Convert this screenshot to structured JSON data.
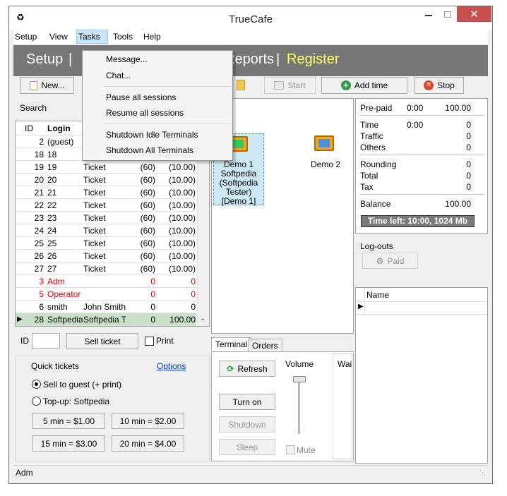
{
  "window": {
    "title": "TrueCafe"
  },
  "menu": {
    "setup": "Setup",
    "view": "View",
    "tasks": "Tasks",
    "tools": "Tools",
    "help": "Help"
  },
  "header": {
    "setup": "Setup",
    "sep1": "|",
    "reports": "Reports",
    "sep2": "|",
    "register": "Register"
  },
  "tasks_menu": {
    "message": "Message...",
    "chat": "Chat...",
    "pause_all": "Pause all sessions",
    "resume_all": "Resume all sessions",
    "shutdown_idle": "Shutdown Idle Terminals",
    "shutdown_all": "Shutdown All Terminals"
  },
  "toolbar": {
    "new_label": "New...",
    "start_label": "Start",
    "add_time_label": "Add time",
    "stop_label": "Stop"
  },
  "search_label": "Search",
  "accounts": {
    "headers": {
      "id": "ID",
      "login": "Login"
    },
    "rows": [
      {
        "id": "2",
        "login": "(guest)",
        "type": "",
        "time": "",
        "amount": "",
        "color": "normal"
      },
      {
        "id": "18",
        "login": "18",
        "type": "Ticket",
        "time": "",
        "amount": "",
        "color": "normal"
      },
      {
        "id": "19",
        "login": "19",
        "type": "Ticket",
        "time": "(60)",
        "amount": "(10.00)",
        "color": "normal"
      },
      {
        "id": "20",
        "login": "20",
        "type": "Ticket",
        "time": "(60)",
        "amount": "(10.00)",
        "color": "normal"
      },
      {
        "id": "21",
        "login": "21",
        "type": "Ticket",
        "time": "(60)",
        "amount": "(10.00)",
        "color": "normal"
      },
      {
        "id": "22",
        "login": "22",
        "type": "Ticket",
        "time": "(60)",
        "amount": "(10.00)",
        "color": "normal"
      },
      {
        "id": "23",
        "login": "23",
        "type": "Ticket",
        "time": "(60)",
        "amount": "(10.00)",
        "color": "normal"
      },
      {
        "id": "24",
        "login": "24",
        "type": "Ticket",
        "time": "(60)",
        "amount": "(10.00)",
        "color": "normal"
      },
      {
        "id": "25",
        "login": "25",
        "type": "Ticket",
        "time": "(60)",
        "amount": "(10.00)",
        "color": "normal"
      },
      {
        "id": "26",
        "login": "26",
        "type": "Ticket",
        "time": "(60)",
        "amount": "(10.00)",
        "color": "normal"
      },
      {
        "id": "27",
        "login": "27",
        "type": "Ticket",
        "time": "(60)",
        "amount": "(10.00)",
        "color": "normal"
      },
      {
        "id": "3",
        "login": "Adm",
        "type": "",
        "time": "0",
        "amount": "0",
        "color": "red"
      },
      {
        "id": "5",
        "login": "Operator",
        "type": "",
        "time": "0",
        "amount": "0",
        "color": "red"
      },
      {
        "id": "6",
        "login": "smith",
        "type": "John Smith",
        "time": "0",
        "amount": "0",
        "color": "normal"
      },
      {
        "id": "28",
        "login": "Softpedia",
        "type": "Softpedia Te",
        "time": "0",
        "amount": "100.00",
        "color": "selected"
      }
    ]
  },
  "ticket": {
    "id_label": "ID",
    "sell_label": "Sell ticket",
    "print_label": "Print"
  },
  "quick": {
    "title": "Quick tickets",
    "options": "Options",
    "sell_guest": "Sell to guest (+ print)",
    "topup": "Top-up: Softpedia",
    "btn1": "5 min = $1.00",
    "btn2": "10 min = $2.00",
    "btn3": "15 min = $3.00",
    "btn4": "20 min = $4.00"
  },
  "terminals": {
    "demo1": "Demo 1 Softpedia (Softpedia Tester) [Demo 1]",
    "demo2": "Demo 2"
  },
  "term_tabs": {
    "terminal": "Terminal",
    "orders": "Orders"
  },
  "term_ctrl": {
    "refresh": "Refresh",
    "turn_on": "Turn on",
    "shutdown": "Shutdown",
    "sleep": "Sleep",
    "volume": "Volume",
    "mute": "Mute",
    "wai": "Wai"
  },
  "info": {
    "prepaid": "Pre-paid",
    "prepaid_time": "0:00",
    "prepaid_val": "100.00",
    "time": "Time",
    "time_time": "0:00",
    "time_val": "0",
    "traffic": "Traffic",
    "traffic_val": "0",
    "others": "Others",
    "others_val": "0",
    "rounding": "Rounding",
    "rounding_val": "0",
    "total": "Total",
    "total_val": "0",
    "tax": "Tax",
    "tax_val": "0",
    "balance": "Balance",
    "balance_val": "100.00",
    "time_left": "Time left: 10:00, 1024 Mb"
  },
  "logouts": {
    "title": "Log-outs",
    "paid": "Paid",
    "name_header": "Name"
  },
  "status": {
    "user": "Adm"
  }
}
